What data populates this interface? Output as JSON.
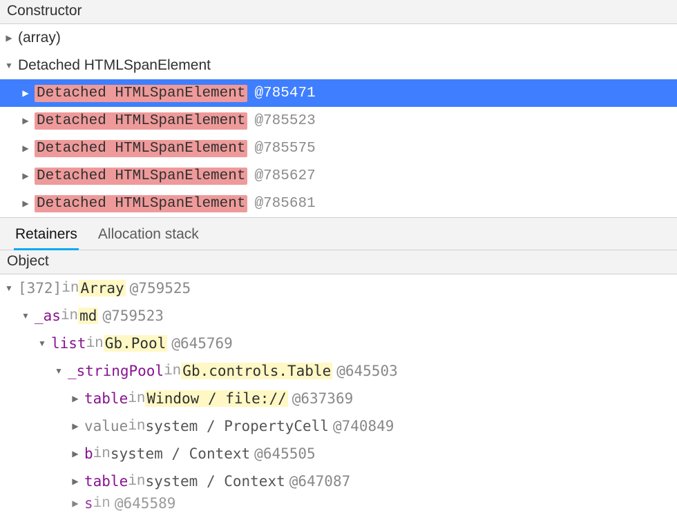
{
  "constructor_panel": {
    "header": "Constructor",
    "rows": [
      {
        "kind": "group",
        "label": "(array)",
        "expanded": false,
        "indent": 0
      },
      {
        "kind": "group",
        "label": "Detached HTMLSpanElement",
        "expanded": true,
        "indent": 0
      },
      {
        "kind": "item",
        "label": "Detached HTMLSpanElement",
        "id": "@785471",
        "indent": 1,
        "selected": true
      },
      {
        "kind": "item",
        "label": "Detached HTMLSpanElement",
        "id": "@785523",
        "indent": 1,
        "selected": false
      },
      {
        "kind": "item",
        "label": "Detached HTMLSpanElement",
        "id": "@785575",
        "indent": 1,
        "selected": false
      },
      {
        "kind": "item",
        "label": "Detached HTMLSpanElement",
        "id": "@785627",
        "indent": 1,
        "selected": false
      },
      {
        "kind": "item",
        "label": "Detached HTMLSpanElement",
        "id": "@785681",
        "indent": 1,
        "selected": false
      }
    ]
  },
  "tabs": {
    "retainers": "Retainers",
    "allocation": "Allocation stack"
  },
  "object_panel": {
    "header": "Object",
    "rows": [
      {
        "indent": 0,
        "expanded": true,
        "prop": "[372]",
        "prop_style": "dim",
        "in": "in",
        "cls": "Array",
        "cls_hl": true,
        "oid": "@759525"
      },
      {
        "indent": 1,
        "expanded": true,
        "prop": "_as",
        "prop_style": "purple",
        "in": "in",
        "cls": "md",
        "cls_hl": true,
        "oid": "@759523"
      },
      {
        "indent": 2,
        "expanded": true,
        "prop": "list",
        "prop_style": "purple",
        "in": "in",
        "cls": "Gb.Pool",
        "cls_hl": true,
        "oid": "@645769"
      },
      {
        "indent": 3,
        "expanded": true,
        "prop": "_stringPool",
        "prop_style": "purple",
        "in": "in",
        "cls": "Gb.controls.Table",
        "cls_hl": true,
        "oid": "@645503"
      },
      {
        "indent": 4,
        "expanded": false,
        "prop": "table",
        "prop_style": "purple",
        "in": "in",
        "cls": "Window / file://",
        "cls_hl": true,
        "oid": "@637369"
      },
      {
        "indent": 4,
        "expanded": false,
        "prop": "value",
        "prop_style": "dim",
        "in": "in",
        "cls": "system / PropertyCell",
        "cls_hl": false,
        "oid": "@740849"
      },
      {
        "indent": 4,
        "expanded": false,
        "prop": "b",
        "prop_style": "purple",
        "in": "in",
        "cls": "system / Context",
        "cls_hl": false,
        "oid": "@645505"
      },
      {
        "indent": 4,
        "expanded": false,
        "prop": "table",
        "prop_style": "purple",
        "in": "in",
        "cls": "system / Context",
        "cls_hl": false,
        "oid": "@647087"
      },
      {
        "indent": 4,
        "expanded": false,
        "prop": "s",
        "prop_style": "purple",
        "in": "in",
        "cls": "",
        "cls_hl": false,
        "oid": "@645589",
        "partial": true
      }
    ]
  }
}
